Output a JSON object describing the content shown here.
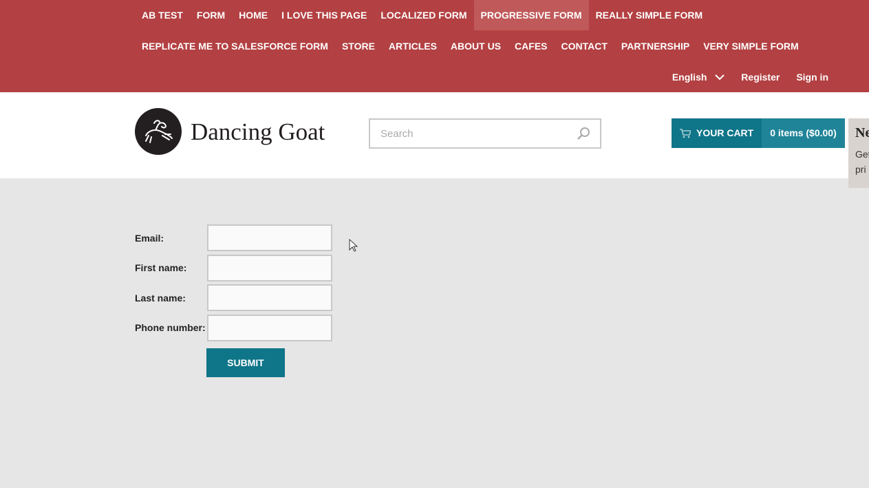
{
  "nav": {
    "row1": [
      {
        "label": "AB TEST"
      },
      {
        "label": "FORM"
      },
      {
        "label": "HOME"
      },
      {
        "label": "I LOVE THIS PAGE"
      },
      {
        "label": "LOCALIZED FORM"
      },
      {
        "label": "PROGRESSIVE FORM",
        "active": true
      },
      {
        "label": "REALLY SIMPLE FORM"
      }
    ],
    "row2": [
      {
        "label": "REPLICATE ME TO SALESFORCE FORM"
      },
      {
        "label": "STORE"
      },
      {
        "label": "ARTICLES"
      },
      {
        "label": "ABOUT US"
      },
      {
        "label": "CAFES"
      },
      {
        "label": "CONTACT"
      },
      {
        "label": "PARTNERSHIP"
      },
      {
        "label": "VERY SIMPLE FORM"
      }
    ]
  },
  "util": {
    "language": "English",
    "register": "Register",
    "signin": "Sign in"
  },
  "header": {
    "brand": "Dancing Goat",
    "search_placeholder": "Search",
    "cart_label": "YOUR CART",
    "cart_summary": "0 items ($0.00)"
  },
  "popup": {
    "title": "Ne",
    "line1": "Get",
    "line2": "pri"
  },
  "form": {
    "fields": [
      {
        "label": "Email:",
        "value": ""
      },
      {
        "label": "First name:",
        "value": ""
      },
      {
        "label": "Last name:",
        "value": ""
      },
      {
        "label": "Phone number:",
        "value": ""
      }
    ],
    "submit": "SUBMIT"
  },
  "colors": {
    "nav_bg": "#b34042",
    "accent": "#0f7589"
  }
}
